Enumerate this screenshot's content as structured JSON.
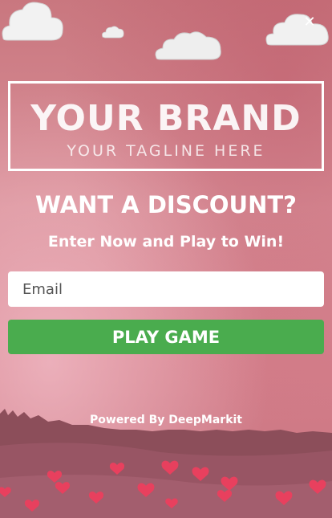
{
  "popup": {
    "close_icon": "close-icon",
    "brand_name": "YOUR BRAND",
    "brand_tagline": "YOUR TAGLINE HERE",
    "headline": "WANT A DISCOUNT?",
    "subheadline": "Enter Now and Play to Win!",
    "email_placeholder": "Email",
    "play_label": "PLAY GAME",
    "powered_by": "Powered By DeepMarkit"
  },
  "colors": {
    "background": "#d98f98",
    "button": "#4aac4e",
    "ground": "#8c4e5a",
    "heart": "#e8405e"
  }
}
